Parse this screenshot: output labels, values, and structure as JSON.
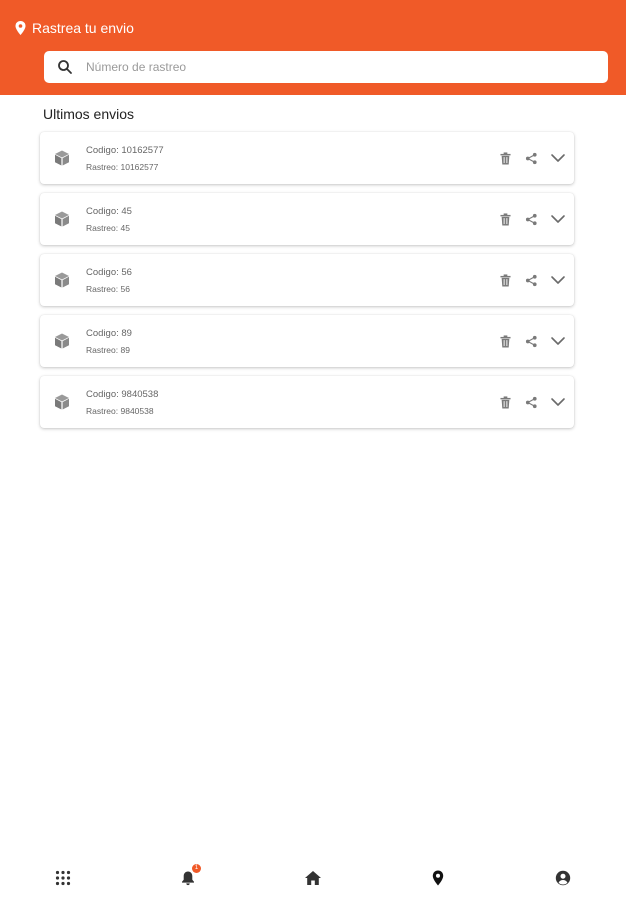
{
  "header": {
    "title": "Rastrea tu envio"
  },
  "search": {
    "placeholder": "Número de rastreo",
    "value": ""
  },
  "section": {
    "title": "Ultimos envios"
  },
  "shipments": [
    {
      "codigo": "Codigo: 10162577",
      "rastreo": "Rastreo: 10162577"
    },
    {
      "codigo": "Codigo: 45",
      "rastreo": "Rastreo: 45"
    },
    {
      "codigo": "Codigo: 56",
      "rastreo": "Rastreo: 56"
    },
    {
      "codigo": "Codigo: 89",
      "rastreo": "Rastreo: 89"
    },
    {
      "codigo": "Codigo: 9840538",
      "rastreo": "Rastreo: 9840538"
    }
  ],
  "nav": {
    "items": [
      "apps-grid-icon",
      "notifications-bell-icon",
      "home-icon",
      "location-pin-icon",
      "account-icon"
    ],
    "notification_count": "1"
  },
  "colors": {
    "accent": "#f05a28",
    "icon_gray": "#8a8a8a",
    "nav_icon": "#333333"
  }
}
